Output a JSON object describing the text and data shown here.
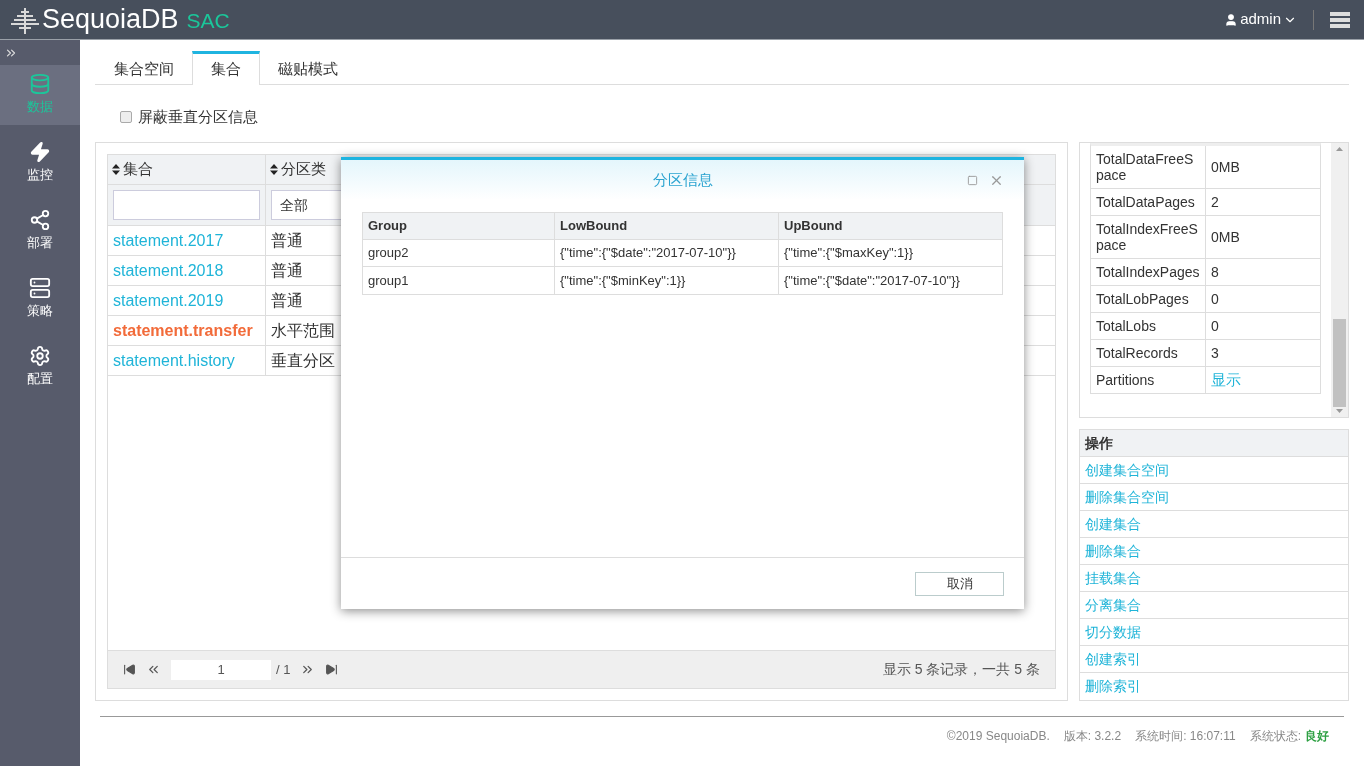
{
  "header": {
    "logo": "SequoiaDB",
    "product": "SAC",
    "user": "admin"
  },
  "sidebar": {
    "items": [
      {
        "label": "数据",
        "selected": true
      },
      {
        "label": "监控",
        "selected": false
      },
      {
        "label": "部署",
        "selected": false
      },
      {
        "label": "策略",
        "selected": false
      },
      {
        "label": "配置",
        "selected": false
      }
    ]
  },
  "tabs": [
    {
      "label": "集合空间",
      "selected": false
    },
    {
      "label": "集合",
      "selected": true
    },
    {
      "label": "磁贴模式",
      "selected": false
    }
  ],
  "filter_checkbox": {
    "label": "屏蔽垂直分区信息",
    "checked": false
  },
  "table": {
    "columns": [
      "集合",
      "分区类"
    ],
    "filter_select": "全部",
    "rows": [
      {
        "name": "statement.2017",
        "type": "普通",
        "selected": false
      },
      {
        "name": "statement.2018",
        "type": "普通",
        "selected": false
      },
      {
        "name": "statement.2019",
        "type": "普通",
        "selected": false
      },
      {
        "name": "statement.transfer",
        "type": "水平范围",
        "selected": true
      },
      {
        "name": "statement.history",
        "type": "垂直分区",
        "selected": false
      }
    ]
  },
  "pager": {
    "page": "1",
    "total_pages": "/ 1",
    "summary": "显示 5 条记录，一共 5 条"
  },
  "properties": [
    {
      "key": "TotalDataFreeSpace",
      "value": "0MB"
    },
    {
      "key": "TotalDataPages",
      "value": "2"
    },
    {
      "key": "TotalIndexFreeSpace",
      "value": "0MB"
    },
    {
      "key": "TotalIndexPages",
      "value": "8"
    },
    {
      "key": "TotalLobPages",
      "value": "0"
    },
    {
      "key": "TotalLobs",
      "value": "0"
    },
    {
      "key": "TotalRecords",
      "value": "3"
    },
    {
      "key": "Partitions",
      "value": "显示",
      "kind": "link"
    }
  ],
  "operations": {
    "title": "操作",
    "items": [
      "创建集合空间",
      "删除集合空间",
      "创建集合",
      "删除集合",
      "挂载集合",
      "分离集合",
      "切分数据",
      "创建索引",
      "删除索引"
    ]
  },
  "dialog": {
    "title": "分区信息",
    "columns": [
      "Group",
      "LowBound",
      "UpBound"
    ],
    "rows": [
      [
        "group2",
        "{\"time\":{\"$date\":\"2017-07-10\"}}",
        "{\"time\":{\"$maxKey\":1}}"
      ],
      [
        "group1",
        "{\"time\":{\"$minKey\":1}}",
        "{\"time\":{\"$date\":\"2017-07-10\"}}"
      ]
    ],
    "cancel": "取消"
  },
  "footer": {
    "copyright": "©2019 SequoiaDB.",
    "version_label": "版本:",
    "version": "3.2.2",
    "time_label": "系统时间:",
    "time": "16:07:11",
    "status_label": "系统状态:",
    "status": "良好"
  }
}
